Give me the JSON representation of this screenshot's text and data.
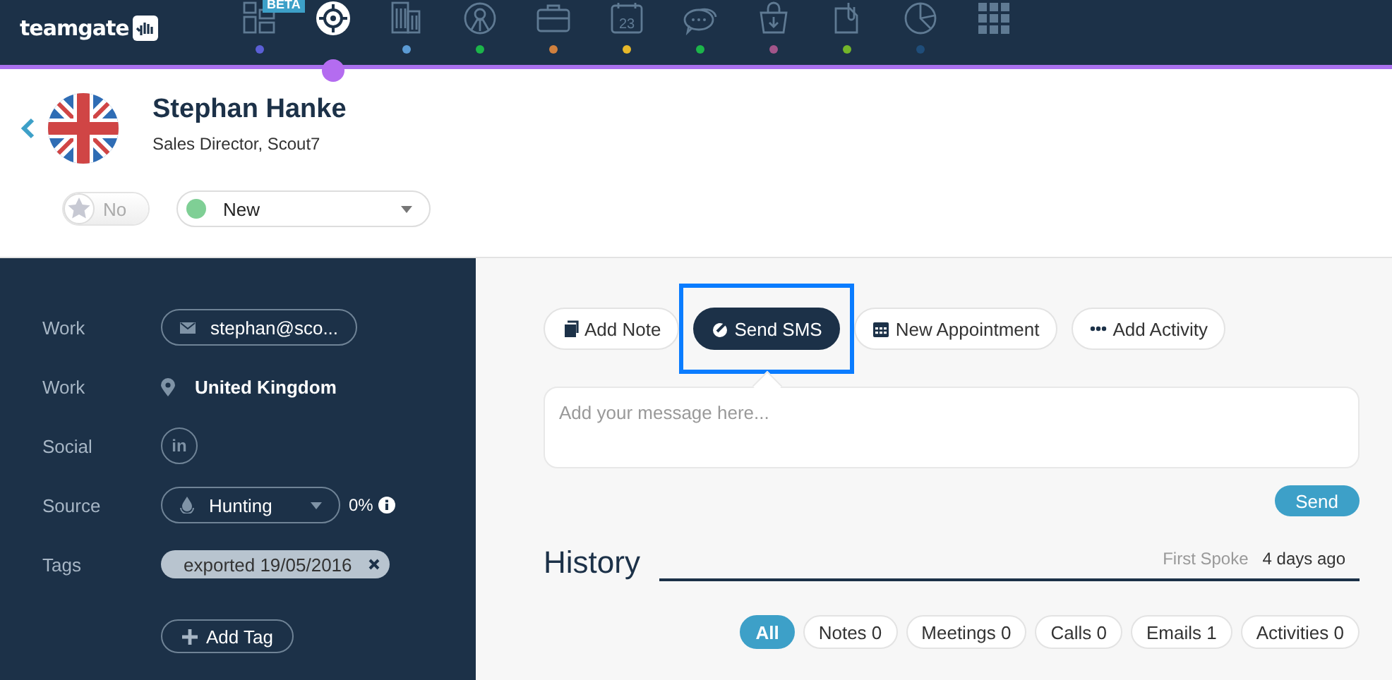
{
  "logo": {
    "text": "teamgate"
  },
  "nav": [
    {
      "kind": "dashboard",
      "badge": "BETA",
      "color": "#5b5fd6",
      "selected": false
    },
    {
      "kind": "target",
      "color": "#b46cf0",
      "selected": true
    },
    {
      "kind": "building",
      "color": "#5b9bd5",
      "selected": false
    },
    {
      "kind": "person",
      "color": "#1cb54a",
      "selected": false
    },
    {
      "kind": "briefcase",
      "color": "#d0803e",
      "selected": false
    },
    {
      "kind": "calendar",
      "text": "23",
      "color": "#e6b82a",
      "selected": false
    },
    {
      "kind": "chat",
      "color": "#1cb54a",
      "selected": false
    },
    {
      "kind": "bag",
      "color": "#a2558a",
      "selected": false
    },
    {
      "kind": "file",
      "color": "#73b52a",
      "selected": false
    },
    {
      "kind": "pie",
      "color": "#1f4d7a",
      "selected": false
    },
    {
      "kind": "apps",
      "selected": false
    }
  ],
  "contact": {
    "name": "Stephan Hanke",
    "subtitle": "Sales Director, Scout7",
    "star": {
      "label": "No",
      "on": false
    },
    "status": {
      "label": "New",
      "color": "#7fcf95"
    }
  },
  "details": [
    {
      "label": "Work",
      "kind": "email",
      "value": "stephan@sco..."
    },
    {
      "label": "Work",
      "kind": "location",
      "value": "United Kingdom"
    },
    {
      "label": "Social",
      "kind": "social",
      "value": "in"
    },
    {
      "label": "Source",
      "kind": "source",
      "value": "Hunting",
      "reading": "0%"
    },
    {
      "label": "Tags",
      "kind": "tags",
      "tags": [
        "exported 19/05/2016"
      ]
    }
  ],
  "add_tag_button": "Add Tag",
  "actions": [
    {
      "label": "Add Note",
      "kind": "note",
      "selected": false
    },
    {
      "label": "Send SMS",
      "kind": "sms",
      "selected": true
    },
    {
      "label": "New Appointment",
      "kind": "calendar",
      "selected": false
    },
    {
      "label": "Add Activity",
      "kind": "more",
      "selected": false
    }
  ],
  "message": {
    "placeholder": "Add your message here..."
  },
  "send_button": "Send",
  "history": {
    "title": "History",
    "first_spoke_label": "First Spoke",
    "first_spoke_value": "4 days ago",
    "filters": [
      {
        "label": "All",
        "selected": true
      },
      {
        "label": "Notes 0",
        "selected": false
      },
      {
        "label": "Meetings 0",
        "selected": false
      },
      {
        "label": "Calls 0",
        "selected": false
      },
      {
        "label": "Emails 1",
        "selected": false
      },
      {
        "label": "Activities 0",
        "selected": false
      }
    ]
  }
}
